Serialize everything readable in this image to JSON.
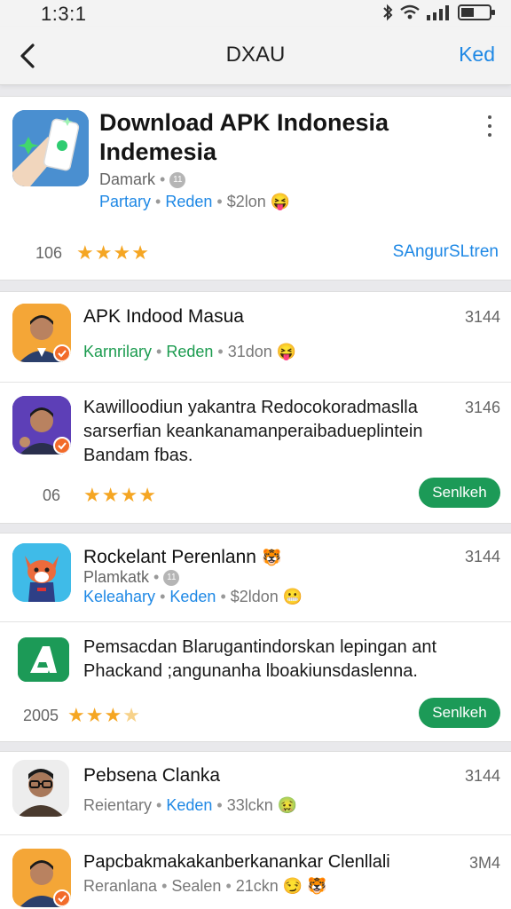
{
  "status": {
    "time": "1:3:1"
  },
  "nav": {
    "title": "DXAU",
    "action": "Ked"
  },
  "featured": {
    "title": "Download APK Indonesia Indemesia",
    "developer": "Damark",
    "badge": "11",
    "tag1": "Partary",
    "tag2": "Reden",
    "price": "$2lon",
    "emoji": "😝",
    "rating_count": "106",
    "stars": 4,
    "link": "SAngurSLtren"
  },
  "card2": {
    "item1": {
      "title": "APK Indood Masua",
      "tag1": "Karnrilary",
      "tag2": "Reden",
      "price": "31don",
      "emoji": "😝",
      "num": "3144"
    },
    "item2": {
      "desc": "Kawilloodiun yakantra Redocokoradmaslla sarserfian keankanamanperaibadueplintein Bandam fbas.",
      "num": "3146",
      "rating_count": "06",
      "stars": 4,
      "button": "Senlkeh"
    }
  },
  "card3": {
    "item1": {
      "title": "Rockelant Perenlann",
      "emoji": "🐯",
      "developer": "Plamkatk",
      "badge": "11",
      "tag1": "Keleahary",
      "tag2": "Keden",
      "price": "$2ldon",
      "emoji2": "😬",
      "num": "3144"
    },
    "item2": {
      "desc": "Pemsacdan Blarugantindorskan lepingan ant Phackand ;angunanha lboakiunsdaslenna.",
      "rating_count": "2005",
      "stars": 3,
      "button": "Senlkeh"
    }
  },
  "card4": {
    "item1": {
      "title": "Pebsena Clanka",
      "tag1": "Reientary",
      "tag2": "Keden",
      "price": "33lckn",
      "emoji": "🤢",
      "num": "3144"
    },
    "item2": {
      "title": "Papcbakmakakanberkanankar Clenllali",
      "tag1": "Reranlana",
      "tag2": "Sealen",
      "price": "21ckn",
      "emoji": "😏",
      "emoji2": "🐯",
      "num": "3M4"
    }
  }
}
